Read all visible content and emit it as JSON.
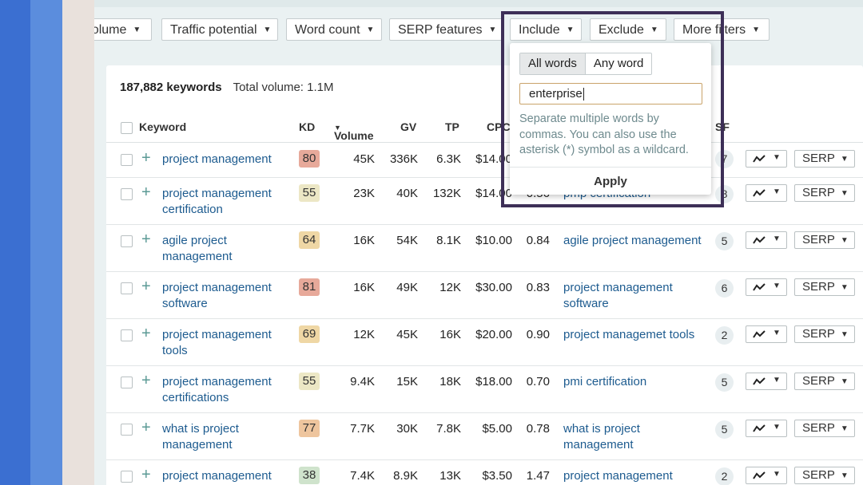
{
  "filters": {
    "volume": "Volume",
    "traffic_potential": "Traffic potential",
    "word_count": "Word count",
    "serp_features": "SERP features",
    "include": "Include",
    "exclude": "Exclude",
    "more_filters": "More filters"
  },
  "summary": {
    "count": "187,882 keywords",
    "total_volume": "Total volume: 1.1M"
  },
  "table": {
    "headers": {
      "keyword": "Keyword",
      "kd": "KD",
      "volume": "Volume",
      "gv": "GV",
      "tp": "TP",
      "cpc": "CPC",
      "sf": "SF"
    },
    "rows": [
      {
        "keyword": "project management",
        "kd": "80",
        "kd_color": "#e7a99a",
        "volume": "45K",
        "gv": "336K",
        "tp": "6.3K",
        "cpc": "$14.00",
        "cps": "",
        "parent": "",
        "sf": "7"
      },
      {
        "keyword": "project management certification",
        "kd": "55",
        "kd_color": "#ece7c5",
        "volume": "23K",
        "gv": "40K",
        "tp": "132K",
        "cpc": "$14.00",
        "cps": "0.56",
        "parent": "pmp certification",
        "sf": "8"
      },
      {
        "keyword": "agile project management",
        "kd": "64",
        "kd_color": "#efd7a5",
        "volume": "16K",
        "gv": "54K",
        "tp": "8.1K",
        "cpc": "$10.00",
        "cps": "0.84",
        "parent": "agile project management",
        "sf": "5"
      },
      {
        "keyword": "project management software",
        "kd": "81",
        "kd_color": "#e7a99a",
        "volume": "16K",
        "gv": "49K",
        "tp": "12K",
        "cpc": "$30.00",
        "cps": "0.83",
        "parent": "project management software",
        "sf": "6"
      },
      {
        "keyword": "project management tools",
        "kd": "69",
        "kd_color": "#efd7a5",
        "volume": "12K",
        "gv": "45K",
        "tp": "16K",
        "cpc": "$20.00",
        "cps": "0.90",
        "parent": "project managemet tools",
        "sf": "2"
      },
      {
        "keyword": "project management certifications",
        "kd": "55",
        "kd_color": "#ece7c5",
        "volume": "9.4K",
        "gv": "15K",
        "tp": "18K",
        "cpc": "$18.00",
        "cps": "0.70",
        "parent": "pmi certification",
        "sf": "5"
      },
      {
        "keyword": "what is project management",
        "kd": "77",
        "kd_color": "#eec59e",
        "volume": "7.7K",
        "gv": "30K",
        "tp": "7.8K",
        "cpc": "$5.00",
        "cps": "0.78",
        "parent": "what is project management",
        "sf": "5"
      },
      {
        "keyword": "project management",
        "kd": "38",
        "kd_color": "#cfe3cc",
        "volume": "7.4K",
        "gv": "8.9K",
        "tp": "13K",
        "cpc": "$3.50",
        "cps": "1.47",
        "parent": "project management",
        "sf": "2"
      }
    ],
    "serp_label": "SERP"
  },
  "popup": {
    "all_words": "All words",
    "any_word": "Any word",
    "input_value": "enterprise",
    "help": "Separate multiple words by commas. You can also use the asterisk (*) symbol as a wildcard.",
    "apply": "Apply"
  },
  "icons": {
    "caret": "caret-down-icon",
    "plus": "plus-icon",
    "trend": "trend-icon"
  }
}
